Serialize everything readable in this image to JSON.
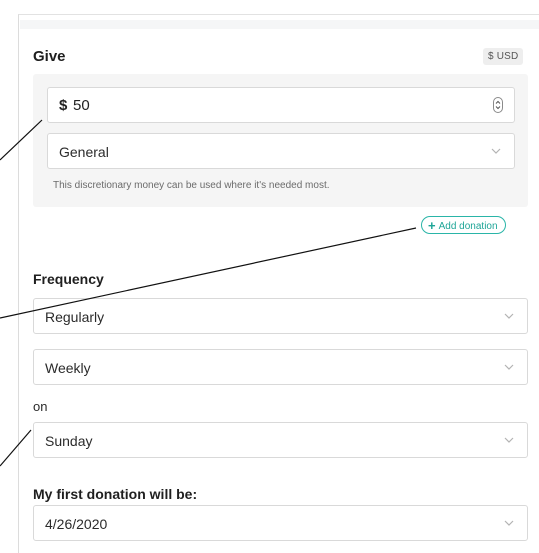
{
  "give": {
    "title": "Give",
    "currency_badge": "$ USD",
    "amount": {
      "symbol": "$",
      "value": "50"
    },
    "fund": {
      "selected": "General",
      "description": "This discretionary money can be used where it's needed most."
    },
    "add_donation_label": "Add donation"
  },
  "frequency": {
    "label": "Frequency",
    "selected": "Regularly",
    "interval": "Weekly",
    "on_label": "on",
    "day": "Sunday"
  },
  "first_donation": {
    "label": "My first donation will be:",
    "date": "4/26/2020"
  },
  "colors": {
    "accent": "#1ea597",
    "accent_border": "#2ab5a8",
    "field_border": "#d9d9d9",
    "group_background": "#f5f5f5"
  },
  "icons": {
    "stepper": "stepper-icon",
    "dropdown": "chevron-down-icon",
    "add": "plus-icon"
  }
}
